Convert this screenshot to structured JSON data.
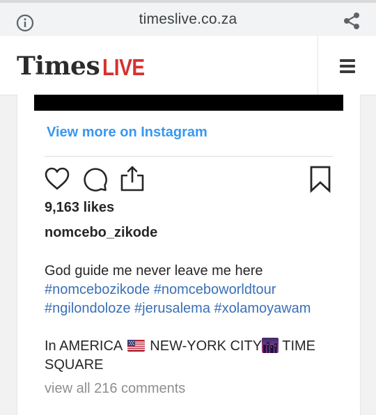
{
  "browser": {
    "url": "timeslive.co.za",
    "icons": {
      "info": "info-icon",
      "share": "share-icon"
    }
  },
  "site": {
    "logo_times": "Times",
    "logo_live": "LIVE",
    "logo_live_color": "#d6312f",
    "menu_icon": "hamburger-menu-icon"
  },
  "instagram": {
    "view_more": "View more on Instagram",
    "link_color": "#3897f0",
    "actions": [
      "heart-icon",
      "comment-icon",
      "share-icon",
      "bookmark-icon"
    ],
    "likes": "9,163 likes",
    "username": "nomcebo_zikode",
    "caption_text": "God guide me never leave me here",
    "hashtags": [
      "#nomcebozikode",
      "#nomceboworldtour",
      "#ngilondoloze",
      "#jerusalema",
      "#xolamoyawam"
    ],
    "caption2_start": "In AMERICA",
    "caption2_mid": "NEW-YORK CITY",
    "caption2_end": "TIME SQUARE",
    "emojis": [
      "us-flag-emoji",
      "night-city-emoji"
    ],
    "comments_link": "view all 216 comments"
  }
}
